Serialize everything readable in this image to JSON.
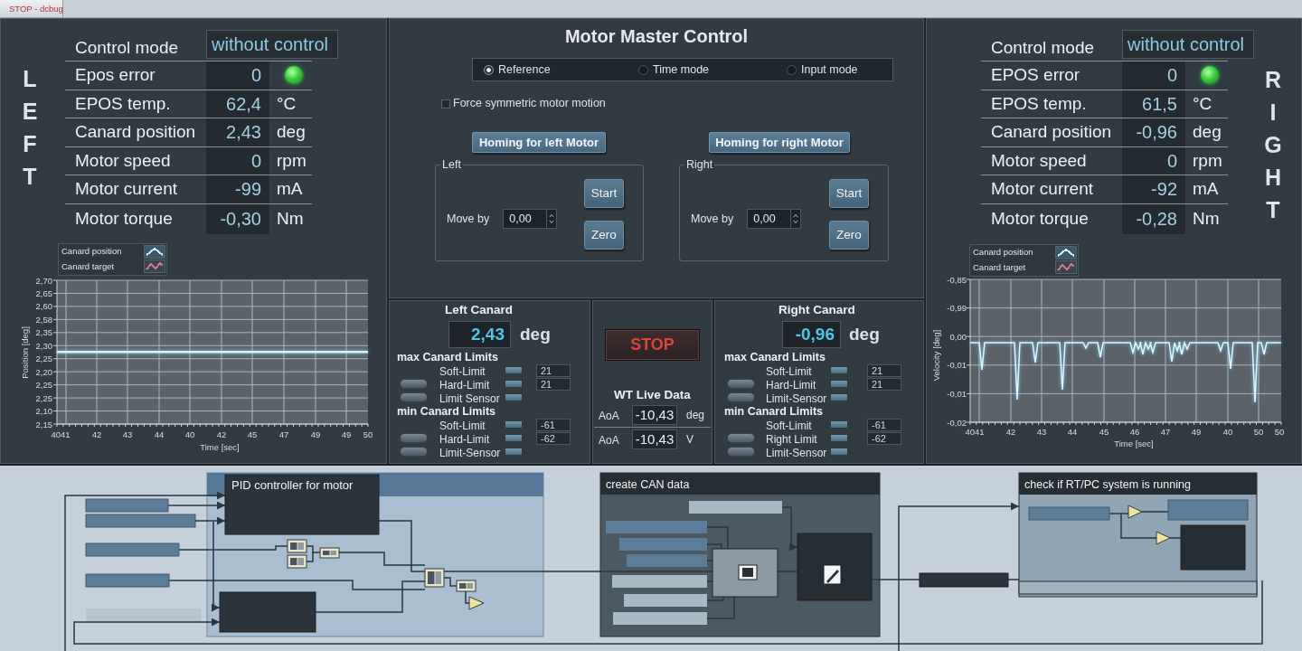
{
  "tab": {
    "label": "STOP - dcbug"
  },
  "left_panel": {
    "side_label": "LEFT",
    "control_mode": {
      "label": "Control mode",
      "value": "without control"
    },
    "readings": [
      {
        "label": "Epos error",
        "value": "0",
        "led": true
      },
      {
        "label": "EPOS temp.",
        "value": "62,4",
        "unit": "°C"
      },
      {
        "label": "Canard position",
        "value": "2,43",
        "unit": "deg"
      },
      {
        "label": "Motor speed",
        "value": "0",
        "unit": "rpm"
      },
      {
        "label": "Motor current",
        "value": "-99",
        "unit": "mA"
      },
      {
        "label": "Motor torque",
        "value": "-0,30",
        "unit": "Nm"
      }
    ],
    "legend": [
      {
        "label": "Canard position",
        "color": "#d6f0fb"
      },
      {
        "label": "Canard target",
        "color": "#c9798b"
      }
    ],
    "chart": {
      "y_axis_label": "Position [deg]",
      "x_axis_label": "Time [sec]",
      "y_tick_labels": [
        "2,70",
        "2,65",
        "2,60",
        "2,58",
        "2,35",
        "2,30",
        "2,25",
        "2,20",
        "2,25",
        "2,25",
        "2,10",
        "2,15"
      ],
      "x_tick_labels": [
        "4041",
        "42",
        "43",
        "44",
        "40",
        "42",
        "45",
        "47",
        "49",
        "49",
        "50"
      ]
    }
  },
  "master_control": {
    "title": "Motor Master Control",
    "modes": [
      {
        "label": "Reference",
        "selected": true
      },
      {
        "label": "Time mode",
        "selected": false
      },
      {
        "label": "Input mode",
        "selected": false
      }
    ],
    "symmetric": {
      "label": "Force symmetric motor motion",
      "checked": false
    },
    "homing": [
      {
        "button": "Homing for left Motor",
        "group": "Left",
        "move_label": "Move by",
        "move_value": "0,00",
        "start": "Start",
        "zero": "Zero"
      },
      {
        "button": "Homing for right Motor",
        "group": "Right",
        "move_label": "Move by",
        "move_value": "0,00",
        "start": "Start",
        "zero": "Zero"
      }
    ]
  },
  "canards": [
    {
      "title": "Left Canard",
      "value": "2,43",
      "unit": "deg",
      "groups": [
        {
          "title": "max Canard Limits",
          "rows": [
            {
              "label": "Soft-Limit",
              "button": false,
              "lit": false,
              "value": "21"
            },
            {
              "label": "Hard-Limit",
              "button": true,
              "lit": false,
              "value": "21"
            },
            {
              "label": "Limit Sensor",
              "button": true,
              "lit": false
            }
          ]
        },
        {
          "title": "min Canard Limits",
          "rows": [
            {
              "label": "Soft-Limit",
              "button": false,
              "lit": false,
              "value": "-61"
            },
            {
              "label": "Hard-Limit",
              "button": true,
              "lit": false,
              "value": "-62"
            },
            {
              "label": "Limit-Sensor",
              "button": true,
              "lit": false
            }
          ]
        }
      ]
    },
    {
      "title": "Right Canard",
      "value": "-0,96",
      "unit": "deg",
      "groups": [
        {
          "title": "max Canard Limits",
          "rows": [
            {
              "label": "Soft-Limit",
              "button": false,
              "lit": false,
              "value": "21"
            },
            {
              "label": "Hard-Limit",
              "button": true,
              "lit": false,
              "value": "21"
            },
            {
              "label": "Limit-Sensor",
              "button": true,
              "lit": false
            }
          ]
        },
        {
          "title": "min Canard Limits",
          "rows": [
            {
              "label": "Soft-Limit",
              "button": false,
              "lit": false,
              "value": "-61"
            },
            {
              "label": "Right Limit",
              "button": true,
              "lit": false,
              "value": "-62"
            },
            {
              "label": "Limit-Sensor",
              "button": true,
              "lit": false
            }
          ]
        }
      ]
    }
  ],
  "live_data": {
    "stop_button": "STOP",
    "title": "WT Live Data",
    "rows": [
      {
        "label": "AoA",
        "value": "-10,43",
        "unit": "deg"
      },
      {
        "label": "AoA",
        "value": "-10,43",
        "unit": "V"
      }
    ]
  },
  "right_panel": {
    "side_label": "RIGHT",
    "control_mode": {
      "label": "Control mode",
      "value": "without control"
    },
    "readings": [
      {
        "label": "EPOS error",
        "value": "0",
        "led": true
      },
      {
        "label": "EPOS temp.",
        "value": "61,5",
        "unit": "°C"
      },
      {
        "label": "Canard position",
        "value": "-0,96",
        "unit": "deg"
      },
      {
        "label": "Motor speed",
        "value": "0",
        "unit": "rpm"
      },
      {
        "label": "Motor current",
        "value": "-92",
        "unit": "mA"
      },
      {
        "label": "Motor torque",
        "value": "-0,28",
        "unit": "Nm"
      }
    ],
    "legend": [
      {
        "label": "Canard position",
        "color": "#d6f0fb"
      },
      {
        "label": "Canard target",
        "color": "#c9798b"
      }
    ],
    "chart": {
      "y_axis_label": "Velocity [deg]",
      "x_axis_label": "Time [sec]",
      "y_tick_labels": [
        "-0,85",
        "-0,99",
        "0,00",
        "-0,01",
        "-0,01",
        "-0,02"
      ],
      "x_tick_labels": [
        "4041",
        "42",
        "43",
        "44",
        "45",
        "46",
        "47",
        "49",
        "40",
        "50",
        "50"
      ]
    }
  },
  "diagram": {
    "blocks": [
      {
        "title": "PID controller for motor"
      },
      {
        "title": "create CAN data"
      },
      {
        "title": "check if RT/PC system is running"
      }
    ]
  }
}
